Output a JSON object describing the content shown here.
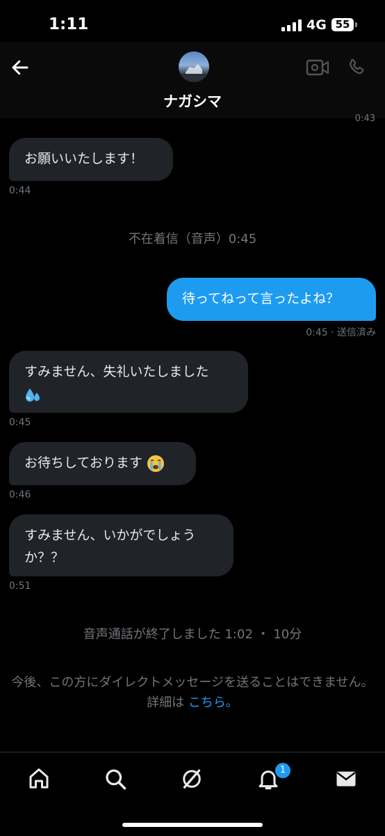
{
  "status": {
    "time": "1:11",
    "network": "4G",
    "battery": "55"
  },
  "header": {
    "contact_name": "ナガシマ",
    "prev_timestamp": "0:43"
  },
  "messages": [
    {
      "text": "お願いいたします！",
      "time": "0:44"
    },
    {
      "system": "不在着信（音声）0:45"
    },
    {
      "text": "待ってねって言ったよね？",
      "time": "0:45 · 送信済み"
    },
    {
      "line1": "すみません、失礼いたしました",
      "emoji": "sweat-droplets-emoji",
      "time": "0:45"
    },
    {
      "text": "お待ちしております",
      "emoji": "loudly-crying-face-emoji",
      "time": "0:46"
    },
    {
      "line1": "すみません、いかがでしょう",
      "line2": "か？？",
      "time": "0:51"
    },
    {
      "system": "音声通話が終了しました 1:02 ・ 10分"
    }
  ],
  "notice": {
    "text": "今後、この方にダイレクトメッセージを送ることはできません。詳細は",
    "link": "こちら。"
  },
  "tabbar": {
    "notifications_badge": "1",
    "icons": [
      "home-icon",
      "search-icon",
      "grok-icon",
      "bell-icon",
      "mail-icon"
    ]
  },
  "colors": {
    "accent": "#1d9bf0",
    "bubble_in": "#202327",
    "muted": "#71767b"
  }
}
